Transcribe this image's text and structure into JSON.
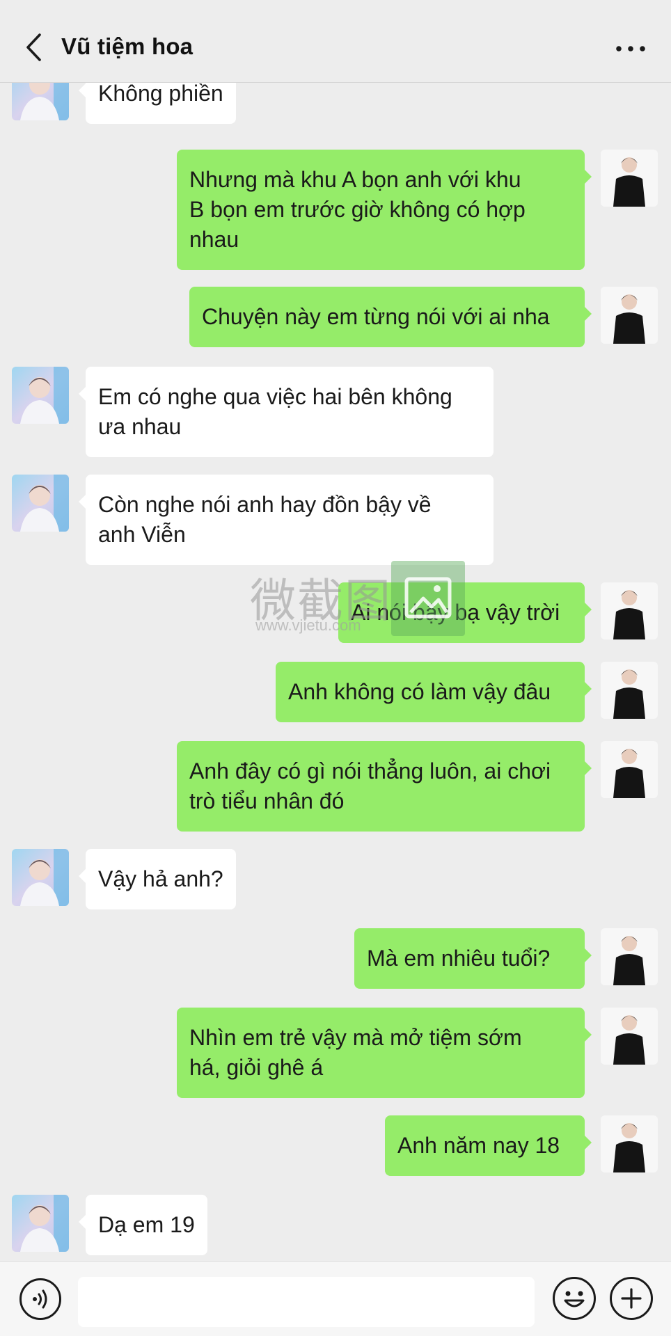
{
  "header": {
    "title": "Vũ tiệm hoa",
    "back_icon": "chevron-left-icon",
    "more_icon": "more-dots-icon"
  },
  "colors": {
    "background": "#ededed",
    "bubble_sent": "#95ec69",
    "bubble_received": "#ffffff"
  },
  "messages": [
    {
      "side": "left",
      "text": "Không phiền"
    },
    {
      "side": "right",
      "text": "Nhưng mà khu A bọn anh với khu\nB bọn em trước giờ không có hợp\nnhau"
    },
    {
      "side": "right",
      "text": "Chuyện này em từng nói với ai nha"
    },
    {
      "side": "left",
      "text": "Em có nghe qua việc hai bên không\nưa nhau"
    },
    {
      "side": "left",
      "text": "Còn nghe nói anh hay đồn bậy về\nanh Viễn"
    },
    {
      "side": "right",
      "text": "Ai nói bậy bạ vậy trời"
    },
    {
      "side": "right",
      "text": "Anh không có làm vậy đâu"
    },
    {
      "side": "right",
      "text": "Anh đây có gì nói thẳng luôn, ai chơi\ntrò tiểu nhân đó"
    },
    {
      "side": "left",
      "text": "Vậy hả anh?"
    },
    {
      "side": "right",
      "text": "Mà em nhiêu tuổi?"
    },
    {
      "side": "right",
      "text": "Nhìn em trẻ vậy mà mở tiệm sớm\nhá, giỏi ghê á"
    },
    {
      "side": "right",
      "text": "Anh năm nay 18"
    },
    {
      "side": "left",
      "text": "Dạ em 19"
    }
  ],
  "watermark": {
    "text": "微截图",
    "url": "www.vjietu.com"
  },
  "input_bar": {
    "voice_icon": "voice-icon",
    "input_value": "",
    "emoji_icon": "emoji-icon",
    "plus_icon": "plus-icon"
  }
}
